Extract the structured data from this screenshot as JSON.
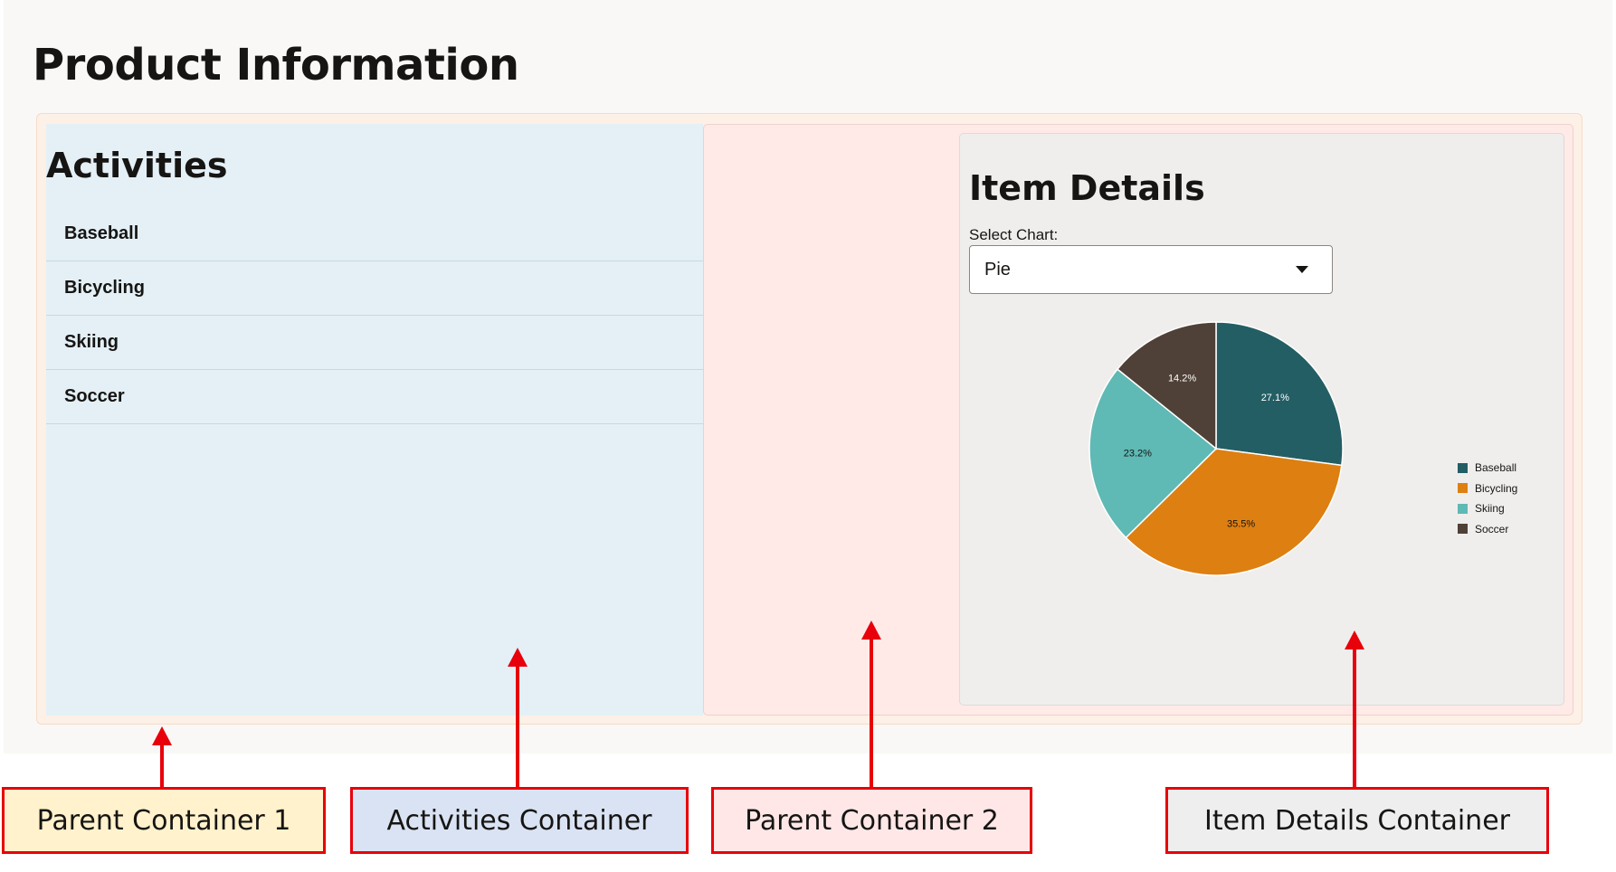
{
  "page": {
    "title": "Product Information"
  },
  "activities": {
    "heading": "Activities",
    "items": [
      {
        "label": "Baseball"
      },
      {
        "label": "Bicycling"
      },
      {
        "label": "Skiing"
      },
      {
        "label": "Soccer"
      }
    ]
  },
  "item_details": {
    "heading": "Item Details",
    "select_label": "Select Chart:",
    "select_value": "Pie"
  },
  "chart_data": {
    "type": "pie",
    "categories": [
      "Baseball",
      "Bicycling",
      "Skiing",
      "Soccer"
    ],
    "values": [
      27.1,
      35.5,
      23.2,
      14.2
    ],
    "labels": [
      "27.1%",
      "35.5%",
      "23.2%",
      "14.2%"
    ],
    "colors": [
      "#235e64",
      "#de7f12",
      "#5fb9b4",
      "#4f4137"
    ],
    "label_colors": [
      "#ffffff",
      "#161513",
      "#161513",
      "#ffffff"
    ],
    "legend_position": "right"
  },
  "annotations": {
    "parent1": {
      "label": "Parent Container 1",
      "color": "#fff2cc"
    },
    "activities": {
      "label": "Activities Container",
      "color": "#dae3f3"
    },
    "parent2": {
      "label": "Parent Container 2",
      "color": "#ffe7e7"
    },
    "details": {
      "label": "Item Details Container",
      "color": "#eeeeee"
    },
    "arrow_color": "#e8000b"
  }
}
